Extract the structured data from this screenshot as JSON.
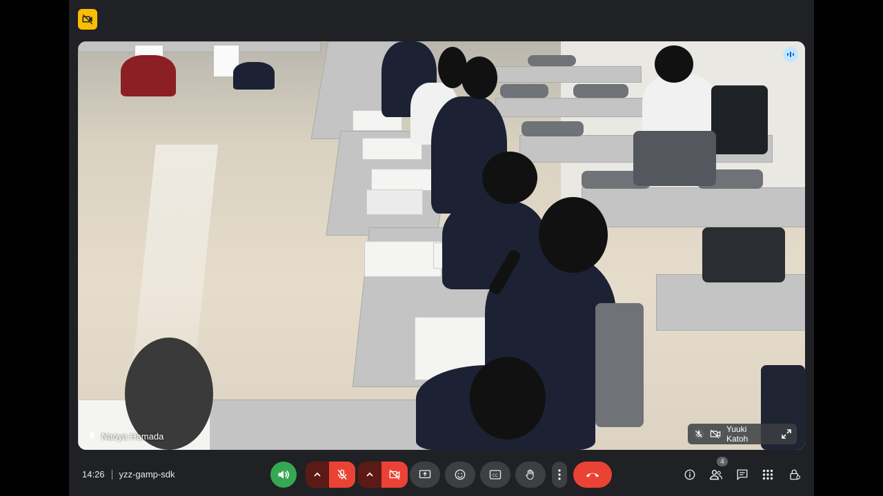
{
  "meeting": {
    "time": "14:26",
    "code": "yzz-gamp-sdk"
  },
  "participants": {
    "count": "4",
    "main_speaker_name": "Naoya Hamada",
    "self_name": "Yuuki Katoh"
  },
  "colors": {
    "accent_green": "#34a853",
    "alert_red": "#ea4335",
    "badge_yellow": "#fbbc04",
    "toolbar_bg": "#202124"
  },
  "icons": {
    "top_badge": "camera-off-icon",
    "speaker": "speaker-volume-icon",
    "mic": "mic-off-icon",
    "camera": "camera-off-icon",
    "present": "present-screen-icon",
    "emoji": "emoji-icon",
    "captions": "captions-icon",
    "hand": "raise-hand-icon",
    "more": "more-vert-icon",
    "hangup": "hang-up-icon",
    "info": "info-icon",
    "people": "people-icon",
    "chat": "chat-icon",
    "activities": "activities-grid-icon",
    "host_controls": "lock-person-icon"
  }
}
